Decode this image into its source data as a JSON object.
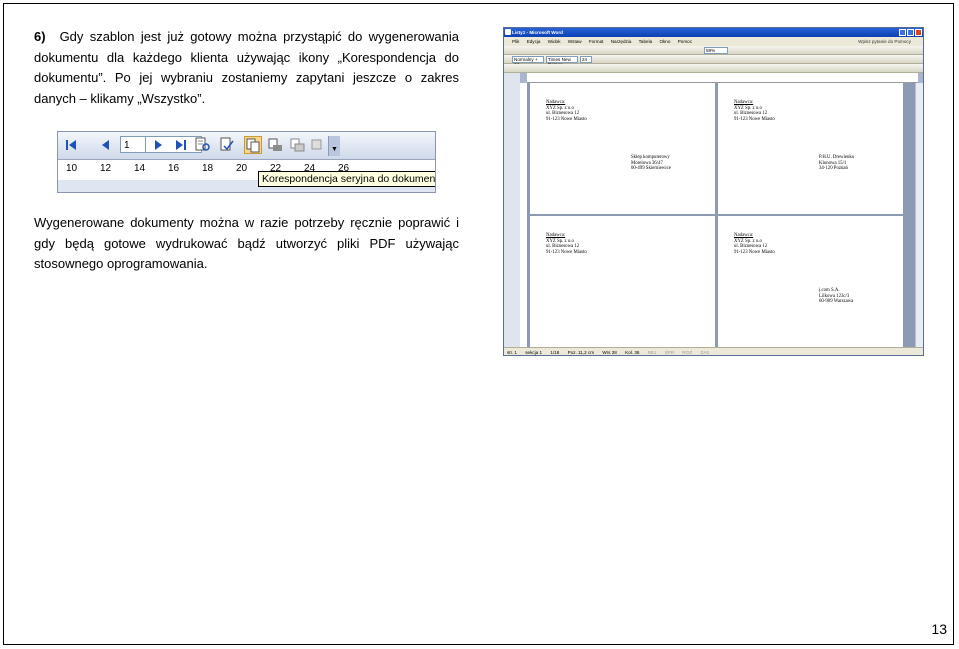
{
  "text": {
    "number": "6)",
    "paragraph1": "Gdy szablon jest już gotowy można przystąpić do wygenerowania dokumentu dla każdego klienta używając ikony „Korespondencja do dokumentu”. Po jej wybraniu zostaniemy zapytani jeszcze o zakres danych – klikamy „Wszystko”.",
    "paragraph2": "Wygenerowane dokumenty można w razie potrzeby ręcznie poprawić i gdy będą gotowe wydrukować bądź utworzyć pliki PDF używając stosownego oprogramowania.",
    "page_number": "13"
  },
  "toolbar_crop": {
    "record_number": "1",
    "ruler_ticks": [
      "10",
      "12",
      "14",
      "16",
      "18",
      "20",
      "22",
      "24",
      "26"
    ],
    "tooltip": "Korespondencja seryjna do dokumentu",
    "icons": [
      "first-record-icon",
      "previous-record-icon",
      "next-record-icon",
      "last-record-icon",
      "find-entry-icon",
      "check-errors-icon",
      "merge-to-new-document-icon",
      "merge-to-printer-icon",
      "merge-to-email-icon"
    ]
  },
  "word": {
    "title": "Listy1 - Microsoft Word",
    "menu": [
      "Plik",
      "Edycja",
      "Widok",
      "Wstaw",
      "Format",
      "Narzędzia",
      "Tabela",
      "Okno",
      "Pomoc"
    ],
    "help_box": "Wpisz pytanie do Pomocy",
    "style": "Normalny + 24",
    "font": "Times New Roman",
    "size": "24",
    "zoom": "59%",
    "status": [
      "str. 1",
      "sekcja 1",
      "1/18",
      "Poz. 11,2 cm",
      "Wrs 28",
      "Kol. 36",
      "REJ",
      "ŚPR",
      "ROZ",
      "ZAS"
    ],
    "labels": [
      {
        "sender": [
          "Nadawca:",
          "XYZ Sp. z o.o",
          "ul. Biznesowa 12",
          "91-123 Nowe Miasto"
        ],
        "recipient": [
          "Sklep komputerowy",
          "Morelowa 36/47",
          "00-499 Skierniewice"
        ]
      },
      {
        "sender": [
          "Nadawca:",
          "XYZ Sp. z o.o",
          "ul. Biznesowa 12",
          "91-123 Nowe Miasto"
        ],
        "recipient": [
          "P.H.U. Drewienko",
          "Klonowa 15/1",
          "34-120 Poznań"
        ]
      },
      {
        "sender": [
          "Nadawca:",
          "XYZ Sp. z o.o",
          "ul. Biznesowa 12",
          "91-123 Nowe Miasto"
        ],
        "recipient": []
      },
      {
        "sender": [
          "Nadawca:",
          "XYZ Sp. z o.o",
          "ul. Biznesowa 12",
          "91-123 Nowe Miasto"
        ],
        "recipient": [
          "j.com S.A.",
          "Lilkowa 123c/3",
          "60-909 Warszawa"
        ]
      }
    ]
  }
}
